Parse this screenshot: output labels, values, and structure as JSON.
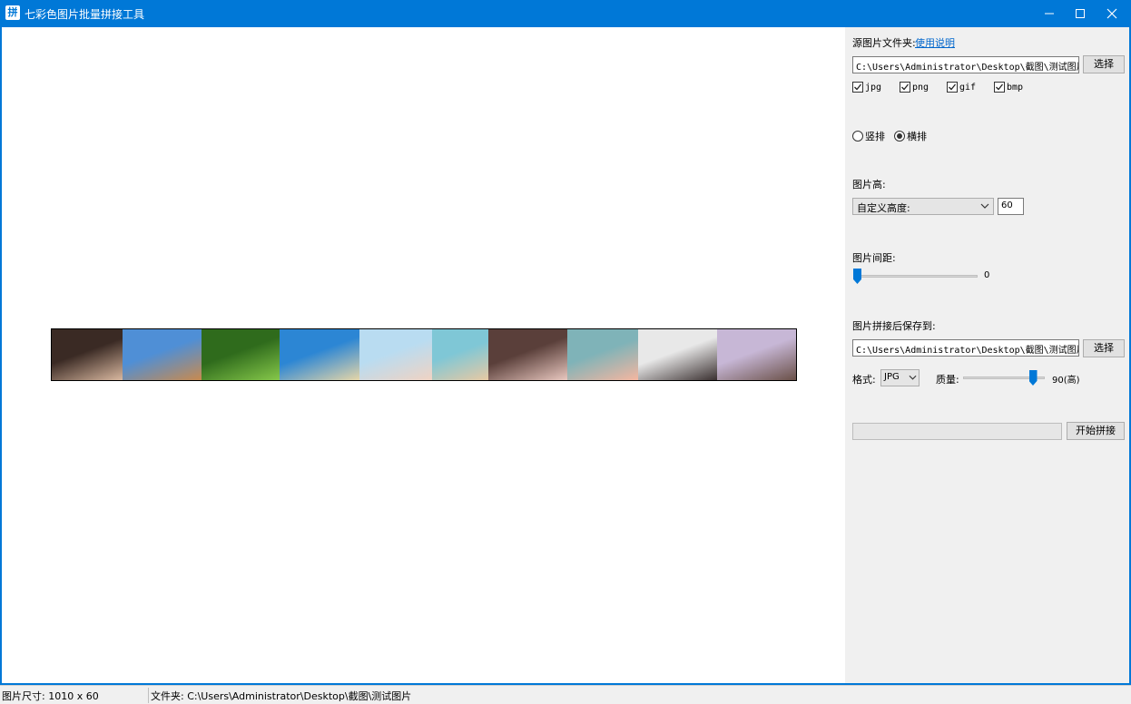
{
  "window": {
    "icon_glyph": "拼",
    "title": "七彩色图片批量拼接工具"
  },
  "preview": {
    "thumbnails": [
      {
        "name": "portrait-woman",
        "color": "#3a2a24",
        "accent": "#d9b8a0"
      },
      {
        "name": "desert-rock",
        "color": "#4f8fd6",
        "accent": "#c98a4e"
      },
      {
        "name": "green-forest",
        "color": "#2f6b1c",
        "accent": "#86c84a"
      },
      {
        "name": "tropical-beach",
        "color": "#2c86d4",
        "accent": "#e6d6a8"
      },
      {
        "name": "woman-blue",
        "color": "#b9dcf1",
        "accent": "#f0d3c3"
      },
      {
        "name": "woman-blonde",
        "color": "#7fc7d6",
        "accent": "#e8c9a3"
      },
      {
        "name": "woman-reclining",
        "color": "#5a3f3a",
        "accent": "#e9c8c0"
      },
      {
        "name": "woman-pool",
        "color": "#7fb3b8",
        "accent": "#f5b6a0"
      },
      {
        "name": "woman-white",
        "color": "#e8e8e8",
        "accent": "#3a3030"
      },
      {
        "name": "woman-lavender",
        "color": "#c7b7d6",
        "accent": "#6a5048"
      }
    ]
  },
  "panel": {
    "source_label": "源图片文件夹:",
    "help_link": "使用说明",
    "source_path": "C:\\Users\\Administrator\\Desktop\\截图\\测试图片",
    "choose_label": "选择",
    "formats": [
      {
        "label": "jpg",
        "checked": true
      },
      {
        "label": "png",
        "checked": true
      },
      {
        "label": "gif",
        "checked": true
      },
      {
        "label": "bmp",
        "checked": true
      }
    ],
    "orientation": [
      {
        "label": "竖排",
        "selected": false
      },
      {
        "label": "横排",
        "selected": true
      }
    ],
    "height_label": "图片高:",
    "height_mode": "自定义高度:",
    "height_value": "60",
    "spacing_label": "图片间距:",
    "spacing_value": "0",
    "spacing_fraction": 0.0,
    "save_label": "图片拼接后保存到:",
    "save_path": "C:\\Users\\Administrator\\Desktop\\截图\\测试图片_处理后",
    "save_choose_label": "选择",
    "format_label": "格式:",
    "format_value": "JPG",
    "quality_label": "质量:",
    "quality_value": "90(高)",
    "quality_fraction": 0.85,
    "progress_fraction": 0.0,
    "start_label": "开始拼接"
  },
  "status": {
    "size": "图片尺寸: 1010 x 60",
    "folder": "文件夹: C:\\Users\\Administrator\\Desktop\\截图\\测试图片"
  }
}
